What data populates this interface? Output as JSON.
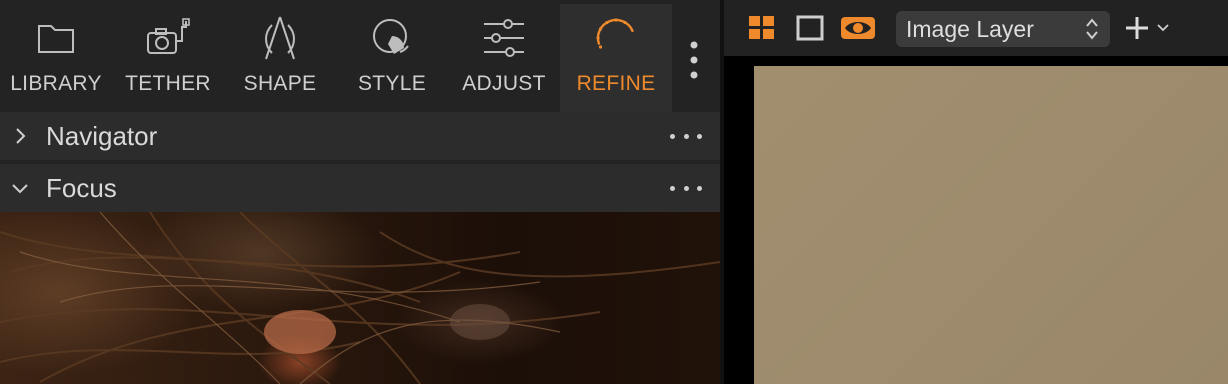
{
  "tabs": [
    {
      "label": "LIBRARY",
      "icon": "folder-icon",
      "active": false
    },
    {
      "label": "TETHER",
      "icon": "tethered-camera-icon",
      "active": false
    },
    {
      "label": "SHAPE",
      "icon": "shape-icon",
      "active": false
    },
    {
      "label": "STYLE",
      "icon": "style-icon",
      "active": false
    },
    {
      "label": "ADJUST",
      "icon": "sliders-icon",
      "active": false
    },
    {
      "label": "REFINE",
      "icon": "refine-icon",
      "active": true
    }
  ],
  "tools": {
    "navigator": {
      "title": "Navigator",
      "expanded": false
    },
    "focus": {
      "title": "Focus",
      "expanded": true
    }
  },
  "viewer_toolbar": {
    "layer_select_value": "Image Layer",
    "icons": [
      "grid-view-icon",
      "single-view-icon",
      "preview-eye-icon",
      "updown-chevron-icon",
      "add-layer-icon",
      "chevron-down-icon"
    ]
  },
  "colors": {
    "accent": "#ef8a2c",
    "panel_bg": "#232323",
    "tool_header_bg": "#2c2c2c",
    "canvas_tone": "#9e8b6d"
  }
}
